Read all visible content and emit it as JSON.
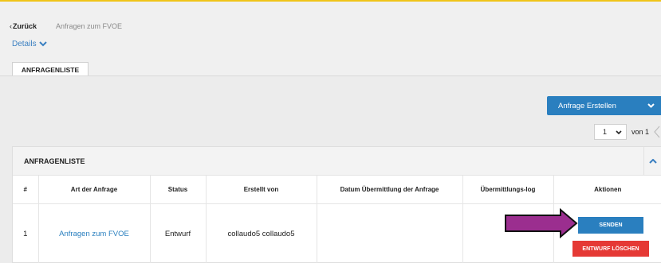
{
  "nav": {
    "back_label": "Zurück",
    "breadcrumb": "Anfragen zum FVOE",
    "details_label": "Details"
  },
  "tabs": [
    {
      "label": "ANFRAGENLISTE"
    }
  ],
  "toolbar": {
    "create_label": "Anfrage Erstellen"
  },
  "pagination": {
    "current_page": "1",
    "of_label": "von",
    "total_pages": "1"
  },
  "panel": {
    "title": "ANFRAGENLISTE"
  },
  "table": {
    "columns": [
      "#",
      "Art der Anfrage",
      "Status",
      "Erstellt von",
      "Datum Übermittlung der Anfrage",
      "Übermittlungs-log",
      "Aktionen"
    ],
    "rows": [
      {
        "num": "1",
        "type": "Anfragen zum FVOE",
        "status": "Entwurf",
        "created_by": "collaudo5 collaudo5",
        "submitted_date": "",
        "log": ""
      }
    ]
  },
  "actions": {
    "send_label": "SENDEN",
    "delete_draft_label": "ENTWURF LÖSCHEN"
  },
  "colors": {
    "accent": "#2a7fbf",
    "danger": "#e53935",
    "highlight_arrow": "#9b2e8f",
    "topline": "#f0c419"
  }
}
